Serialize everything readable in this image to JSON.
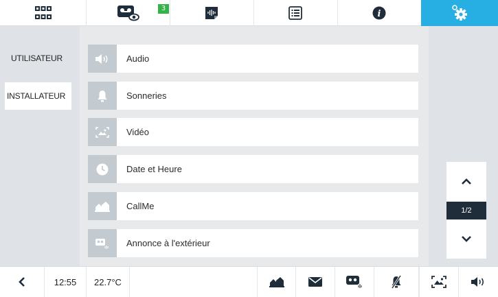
{
  "top_tabs": [
    {
      "name": "home-grid",
      "icon": "grid-icon"
    },
    {
      "name": "voicemail-view",
      "icon": "voicemail-eye-icon",
      "badge": "3"
    },
    {
      "name": "audio-messages",
      "icon": "audio-message-icon"
    },
    {
      "name": "list",
      "icon": "list-icon"
    },
    {
      "name": "info",
      "icon": "info-icon"
    },
    {
      "name": "settings",
      "icon": "gear-icon",
      "active": true
    }
  ],
  "sidebar": {
    "items": [
      {
        "label": "UTILISATEUR",
        "selected": true
      },
      {
        "label": "INSTALLATEUR",
        "selected": false
      }
    ]
  },
  "menu": {
    "items": [
      {
        "label": "Audio",
        "icon": "speaker-icon"
      },
      {
        "label": "Sonneries",
        "icon": "bell-icon"
      },
      {
        "label": "Vidéo",
        "icon": "video-image-icon"
      },
      {
        "label": "Date et Heure",
        "icon": "clock-icon"
      },
      {
        "label": "CallMe",
        "icon": "callme-houses-icon"
      },
      {
        "label": "Annonce à l'extérieur",
        "icon": "outdoor-announce-icon"
      }
    ]
  },
  "pager": {
    "page_label": "1/2"
  },
  "bottombar": {
    "time": "12:55",
    "temperature": "22.7°C"
  },
  "colors": {
    "accent": "#27aee2",
    "badge": "#36b24a",
    "dark": "#1f2d3a",
    "icon_bg": "#c3cbd1"
  }
}
